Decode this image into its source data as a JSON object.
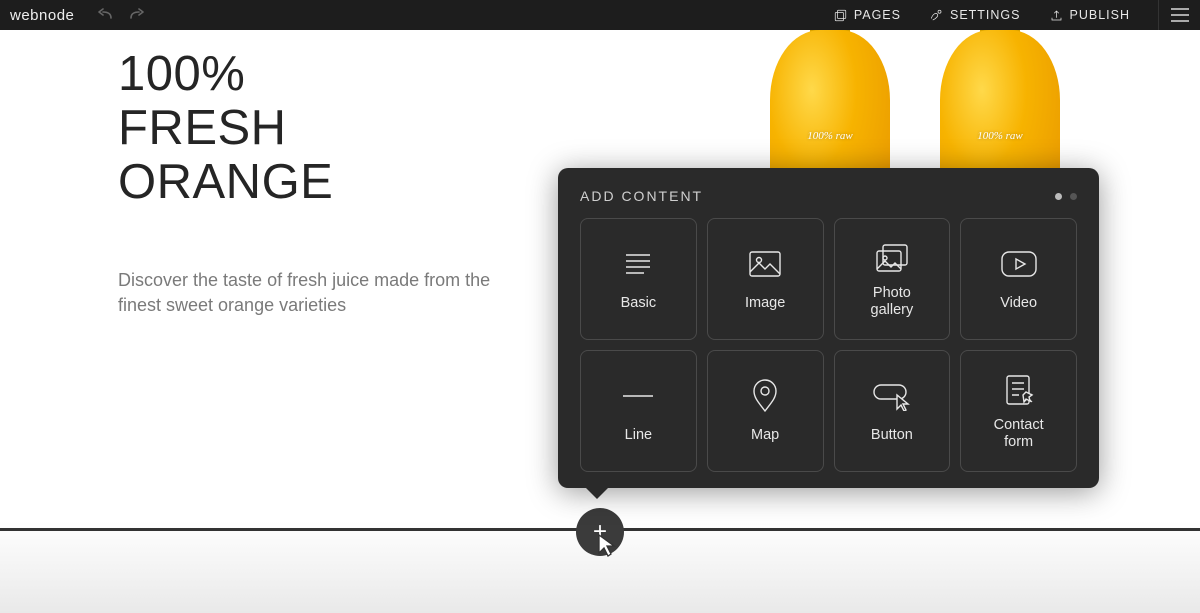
{
  "topbar": {
    "brand": "webnode",
    "pages": "PAGES",
    "settings": "SETTINGS",
    "publish": "PUBLISH"
  },
  "hero": {
    "heading": "100%\nFRESH\nORANGE",
    "subtext": "Discover the taste of fresh juice made from the finest sweet orange varieties"
  },
  "bottle_label": "100% raw",
  "popover": {
    "title": "ADD CONTENT",
    "items": [
      {
        "key": "basic",
        "label": "Basic",
        "icon": "text-lines-icon"
      },
      {
        "key": "image",
        "label": "Image",
        "icon": "image-icon"
      },
      {
        "key": "gallery",
        "label": "Photo\ngallery",
        "icon": "gallery-icon"
      },
      {
        "key": "video",
        "label": "Video",
        "icon": "video-icon"
      },
      {
        "key": "line",
        "label": "Line",
        "icon": "line-icon"
      },
      {
        "key": "map",
        "label": "Map",
        "icon": "pin-icon"
      },
      {
        "key": "button",
        "label": "Button",
        "icon": "button-icon"
      },
      {
        "key": "contact",
        "label": "Contact\nform",
        "icon": "form-icon"
      }
    ]
  }
}
